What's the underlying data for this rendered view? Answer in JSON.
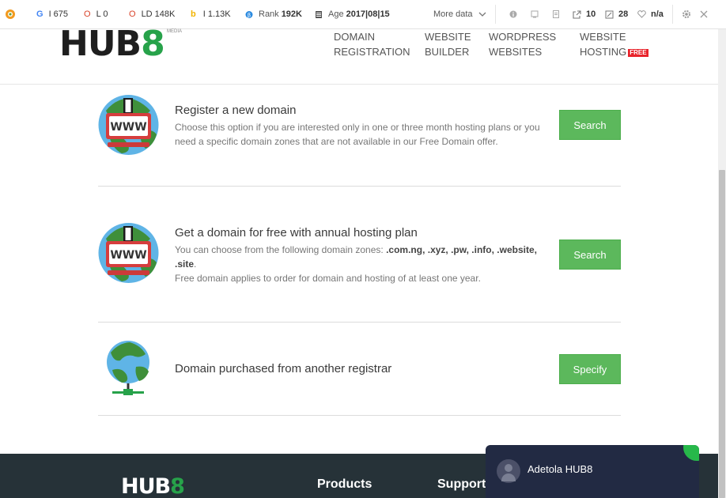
{
  "seo_toolbar": {
    "google": {
      "icon": "G",
      "value": "I 675"
    },
    "opera": {
      "icon": "O",
      "value": "L 0"
    },
    "ld": {
      "icon": "O",
      "value": "LD 148K"
    },
    "bing": {
      "icon": "b",
      "value": "I 1.13K"
    },
    "rank": {
      "label": "Rank",
      "value": "192K"
    },
    "age": {
      "label": "Age",
      "value": "2017|08|15"
    },
    "more_data": "More data",
    "links_out": "10",
    "links_in": "28",
    "na": "n/a"
  },
  "header": {
    "logo_main": "HUB",
    "logo_eight": "8",
    "logo_sub": "MEDIA",
    "nav": [
      {
        "line1": "DOMAIN",
        "line2": "REGISTRATION"
      },
      {
        "line1": "WEBSITE",
        "line2": "BUILDER"
      },
      {
        "line1": "WORDPRESS",
        "line2": "WEBSITES"
      },
      {
        "line1": "WEBSITE",
        "line2": "HOSTING",
        "badge": "FREE"
      }
    ]
  },
  "options": [
    {
      "title": "Register a new domain",
      "desc": "Choose this option if you are interested only in one or three month hosting plans or you need a specific domain zones that are not available in our Free Domain offer.",
      "button": "Search"
    },
    {
      "title": "Get a domain for free with annual hosting plan",
      "desc_prefix": "You can choose from the following domain zones: ",
      "zones": ".com.ng, .xyz, .pw, .info, .website, .site",
      "desc_suffix": ".",
      "desc2": "Free domain applies to order for domain and hosting of at least one year.",
      "button": "Search"
    },
    {
      "title": "Domain purchased from another registrar",
      "button": "Specify"
    }
  ],
  "www_label": "WWW",
  "footer": {
    "logo_main": "HUB",
    "logo_eight": "8",
    "products": "Products",
    "support": "Support"
  },
  "chat": {
    "name": "Adetola HUB8"
  },
  "colors": {
    "accent_green": "#5cb85c",
    "brand_green": "#27a24a",
    "footer_bg": "#263238",
    "chat_bg": "#222a43",
    "badge_red": "#e8232b"
  }
}
